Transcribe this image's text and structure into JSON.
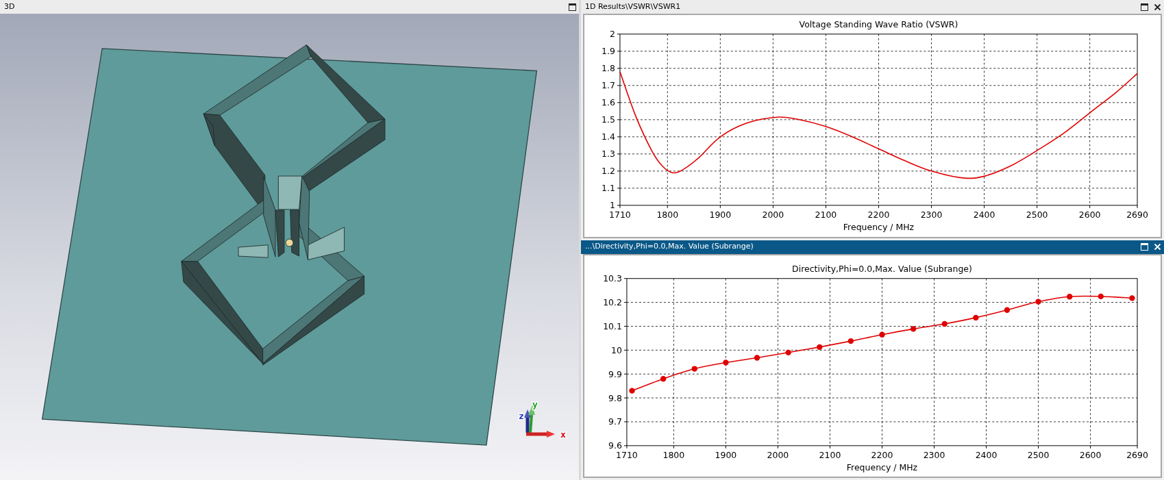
{
  "panes": [
    {
      "title": "3D",
      "active": false,
      "closable": false,
      "kind": "viewport",
      "axis_labels": [
        "x",
        "y",
        "z"
      ]
    },
    {
      "title": "1D Results\\VSWR\\VSWR1",
      "active": false,
      "closable": true,
      "kind": "chart",
      "chart_data": {
        "type": "line",
        "title": "Voltage Standing Wave Ratio (VSWR)",
        "xlabel": "Frequency / MHz",
        "x": [
          1710,
          1740,
          1770,
          1790,
          1810,
          1830,
          1860,
          1900,
          1950,
          2010,
          2050,
          2100,
          2150,
          2200,
          2250,
          2300,
          2360,
          2400,
          2450,
          2500,
          2550,
          2600,
          2650,
          2690
        ],
        "series": [
          {
            "color": "#e00000",
            "values": [
              1.78,
              1.52,
              1.32,
              1.23,
              1.19,
              1.21,
              1.28,
              1.4,
              1.48,
              1.515,
              1.5,
              1.46,
              1.4,
              1.33,
              1.26,
              1.2,
              1.16,
              1.17,
              1.23,
              1.32,
              1.42,
              1.54,
              1.66,
              1.77
            ]
          }
        ],
        "grid": true,
        "xlim": [
          1710,
          2690
        ],
        "ylim": [
          1,
          2
        ],
        "xticks": [
          1710,
          1800,
          1900,
          2000,
          2100,
          2200,
          2300,
          2400,
          2500,
          2600,
          2690
        ],
        "yticks": [
          1,
          1.1,
          1.2,
          1.3,
          1.4,
          1.5,
          1.6,
          1.7,
          1.8,
          1.9,
          2
        ]
      }
    },
    {
      "title": "...\\Directivity,Phi=0.0,Max. Value (Subrange)",
      "active": true,
      "closable": true,
      "kind": "chart",
      "chart_data": {
        "type": "line",
        "title": "Directivity,Phi=0.0,Max. Value (Subrange)",
        "xlabel": "Frequency / MHz",
        "x": [
          1720,
          1780,
          1840,
          1900,
          1960,
          2020,
          2080,
          2140,
          2200,
          2260,
          2320,
          2380,
          2440,
          2500,
          2560,
          2620,
          2680
        ],
        "series": [
          {
            "color": "#e00000",
            "marker": "circle",
            "values": [
              9.83,
              9.88,
              9.922,
              9.948,
              9.968,
              9.99,
              10.013,
              10.038,
              10.065,
              10.089,
              10.11,
              10.136,
              10.168,
              10.203,
              10.224,
              10.225,
              10.218
            ]
          }
        ],
        "grid": true,
        "xlim": [
          1710,
          2690
        ],
        "ylim": [
          9.6,
          10.3
        ],
        "xticks": [
          1710,
          1800,
          1900,
          2000,
          2100,
          2200,
          2300,
          2400,
          2500,
          2600,
          2690
        ],
        "yticks": [
          9.6,
          9.7,
          9.8,
          9.9,
          10,
          10.1,
          10.2,
          10.3
        ]
      }
    }
  ]
}
